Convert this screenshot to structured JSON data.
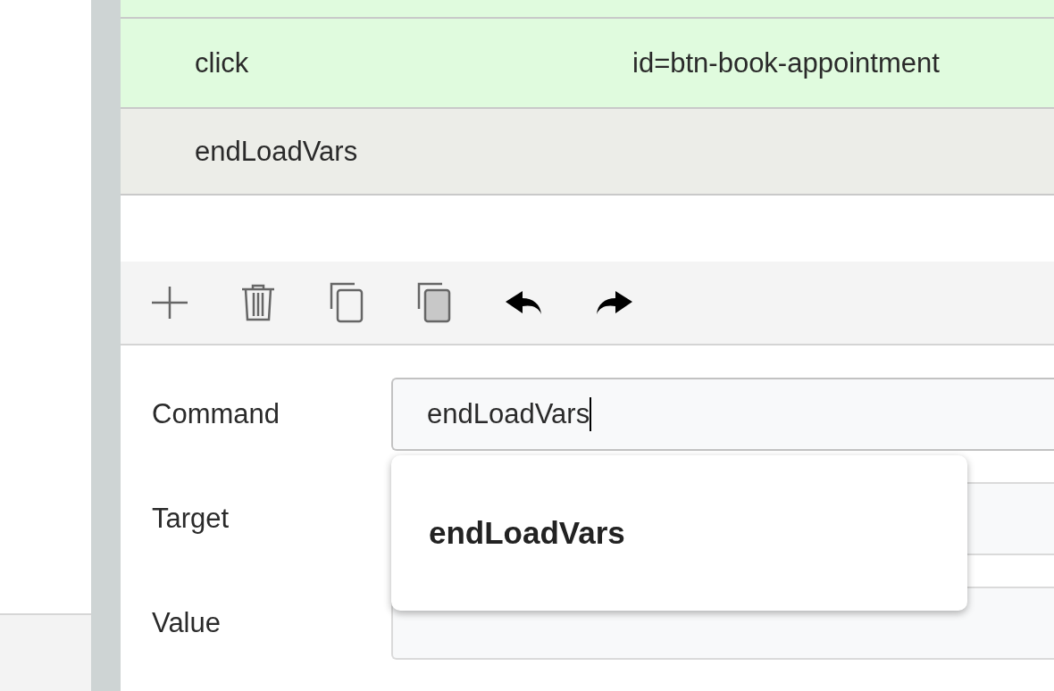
{
  "test_steps": [
    {
      "selected": false
    },
    {
      "command": "click",
      "target": "id=btn-book-appointment",
      "selected": false
    },
    {
      "command": "endLoadVars",
      "selected": true
    }
  ],
  "editor_fields": [
    {
      "label": "Command",
      "value": "endLoadVars",
      "focused": true
    },
    {
      "label": "Target",
      "focused": false
    },
    {
      "label": "Value",
      "focused": false
    }
  ],
  "autocomplete": {
    "suggestions": [
      "endLoadVars"
    ]
  }
}
